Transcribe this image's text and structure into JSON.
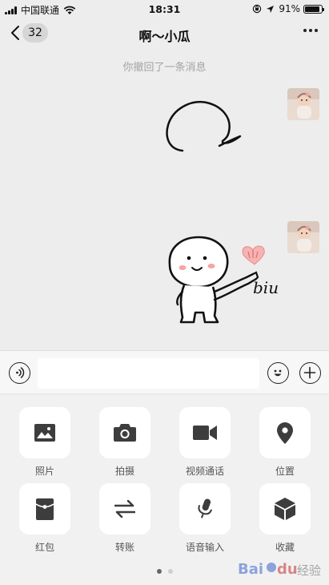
{
  "status_bar": {
    "carrier": "中国联通",
    "time": "18:31",
    "battery": "91%",
    "battery_level": 0.91
  },
  "nav": {
    "badge_count": "32",
    "title": "啊～小瓜"
  },
  "chat": {
    "recall_notice": "你撤回了一条消息",
    "sticker_text": "biu"
  },
  "input": {
    "value": "",
    "placeholder": ""
  },
  "actions": [
    {
      "label": "照片",
      "icon": "photo-icon"
    },
    {
      "label": "拍摄",
      "icon": "camera-icon"
    },
    {
      "label": "视频通话",
      "icon": "video-call-icon"
    },
    {
      "label": "位置",
      "icon": "location-icon"
    },
    {
      "label": "红包",
      "icon": "red-packet-icon"
    },
    {
      "label": "转账",
      "icon": "transfer-icon"
    },
    {
      "label": "语音输入",
      "icon": "microphone-icon"
    },
    {
      "label": "收藏",
      "icon": "favorites-icon"
    }
  ],
  "page_indicator": {
    "pages": 2,
    "current": 1
  },
  "watermark": "Baidu 经验",
  "colors": {
    "background": "#ededed",
    "panel": "#f1f1f1",
    "icon": "#3d3d3d",
    "sticker_blush": "#f4a5a5"
  }
}
